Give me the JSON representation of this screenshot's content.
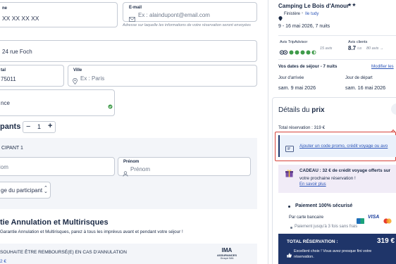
{
  "form": {
    "phone": {
      "label": "ne",
      "value": "XX XX XX XX"
    },
    "email": {
      "label": "E-mail",
      "placeholder": "Ex : alaindupont@email.com",
      "note": "Adresse sur laquelle les informations de votre réservation seront envoyées"
    },
    "address": {
      "value": "24 rue Foch"
    },
    "postal": {
      "label": "tal",
      "value": "75011"
    },
    "city": {
      "label": "Ville",
      "placeholder": "Ex : Paris"
    },
    "country": {
      "value": "nce"
    },
    "participants": {
      "title": "pants",
      "minus": "−",
      "count": "1",
      "plus": "+"
    },
    "participant1": {
      "heading": "CIPANT 1",
      "lastname_placeholder": "Nom",
      "firstname_label": "Prénom",
      "firstname_placeholder": "Prénom",
      "age_placeholder": "ge du participant"
    },
    "insurance": {
      "title": "tie Annulation et Multirisques",
      "desc": "Garantie Annulation et Multirisques, parez à tous les imprévus avant et pendant votre séjour !",
      "option": "SOUHAITE ÊTRE REMBOURSÉ(E) EN CAS D'ANNULATION",
      "price": "2 €",
      "logo_main": "IMA",
      "logo_sub": "ASSURANCES",
      "logo_group": "Groupe IMA"
    }
  },
  "summary": {
    "camping_name": "Camping Le Bois d'Amour",
    "stars": "★★",
    "region": "Finistère",
    "town": "Ile tudy",
    "dates": "9 - 16 mai 2026, 7 nuits",
    "tripadvisor_label": "Avis TripAdvisor",
    "tripadvisor_count": "15 avis",
    "tripadvisor_rating": 4.5,
    "clients_label": "Avis clients",
    "clients_score": "8.7",
    "clients_scale": "/10",
    "clients_count": "80 avis →",
    "stay_label": "Vos dates de séjour - 7 nuits",
    "modify_link": "Modifier les",
    "arrival_label": "Jour d'arrivée",
    "arrival_value": "sam. 9 mai 2026",
    "departure_label": "Jour de départ",
    "departure_value": "sam. 16 mai 2026"
  },
  "price": {
    "title_prefix": "Détails du ",
    "title_bold": "prix",
    "total_label": "Total réservation : 319 €",
    "promo_link": "Ajouter un code promo, crédit voyage ou avo",
    "gift_text_bold": "CADEAU : 32 € de crédit voyage offerts sur",
    "gift_text": "votre prochaine réservation !",
    "gift_link": "En savoir plus",
    "secure_label": "Paiement 100% sécurisé",
    "card_label": "Par carte bancaire",
    "card_visa": "VISA",
    "installments": "Paiement jusqu'à 3 fois sans frais",
    "total_bar_label": "TOTAL RÉSERVATION :",
    "total_bar_value": "319 €",
    "excellent_text": "Excellent choix ! Vous avez presque fini votre réservation."
  },
  "colors": {
    "navy": "#1f3569",
    "accent_red": "#d6423a",
    "promo_bg": "#eaf1fb",
    "gift_bg": "#f1ecf7",
    "form_bg": "#f3f5f9",
    "tripadvisor_green": "#3f9b4a"
  }
}
